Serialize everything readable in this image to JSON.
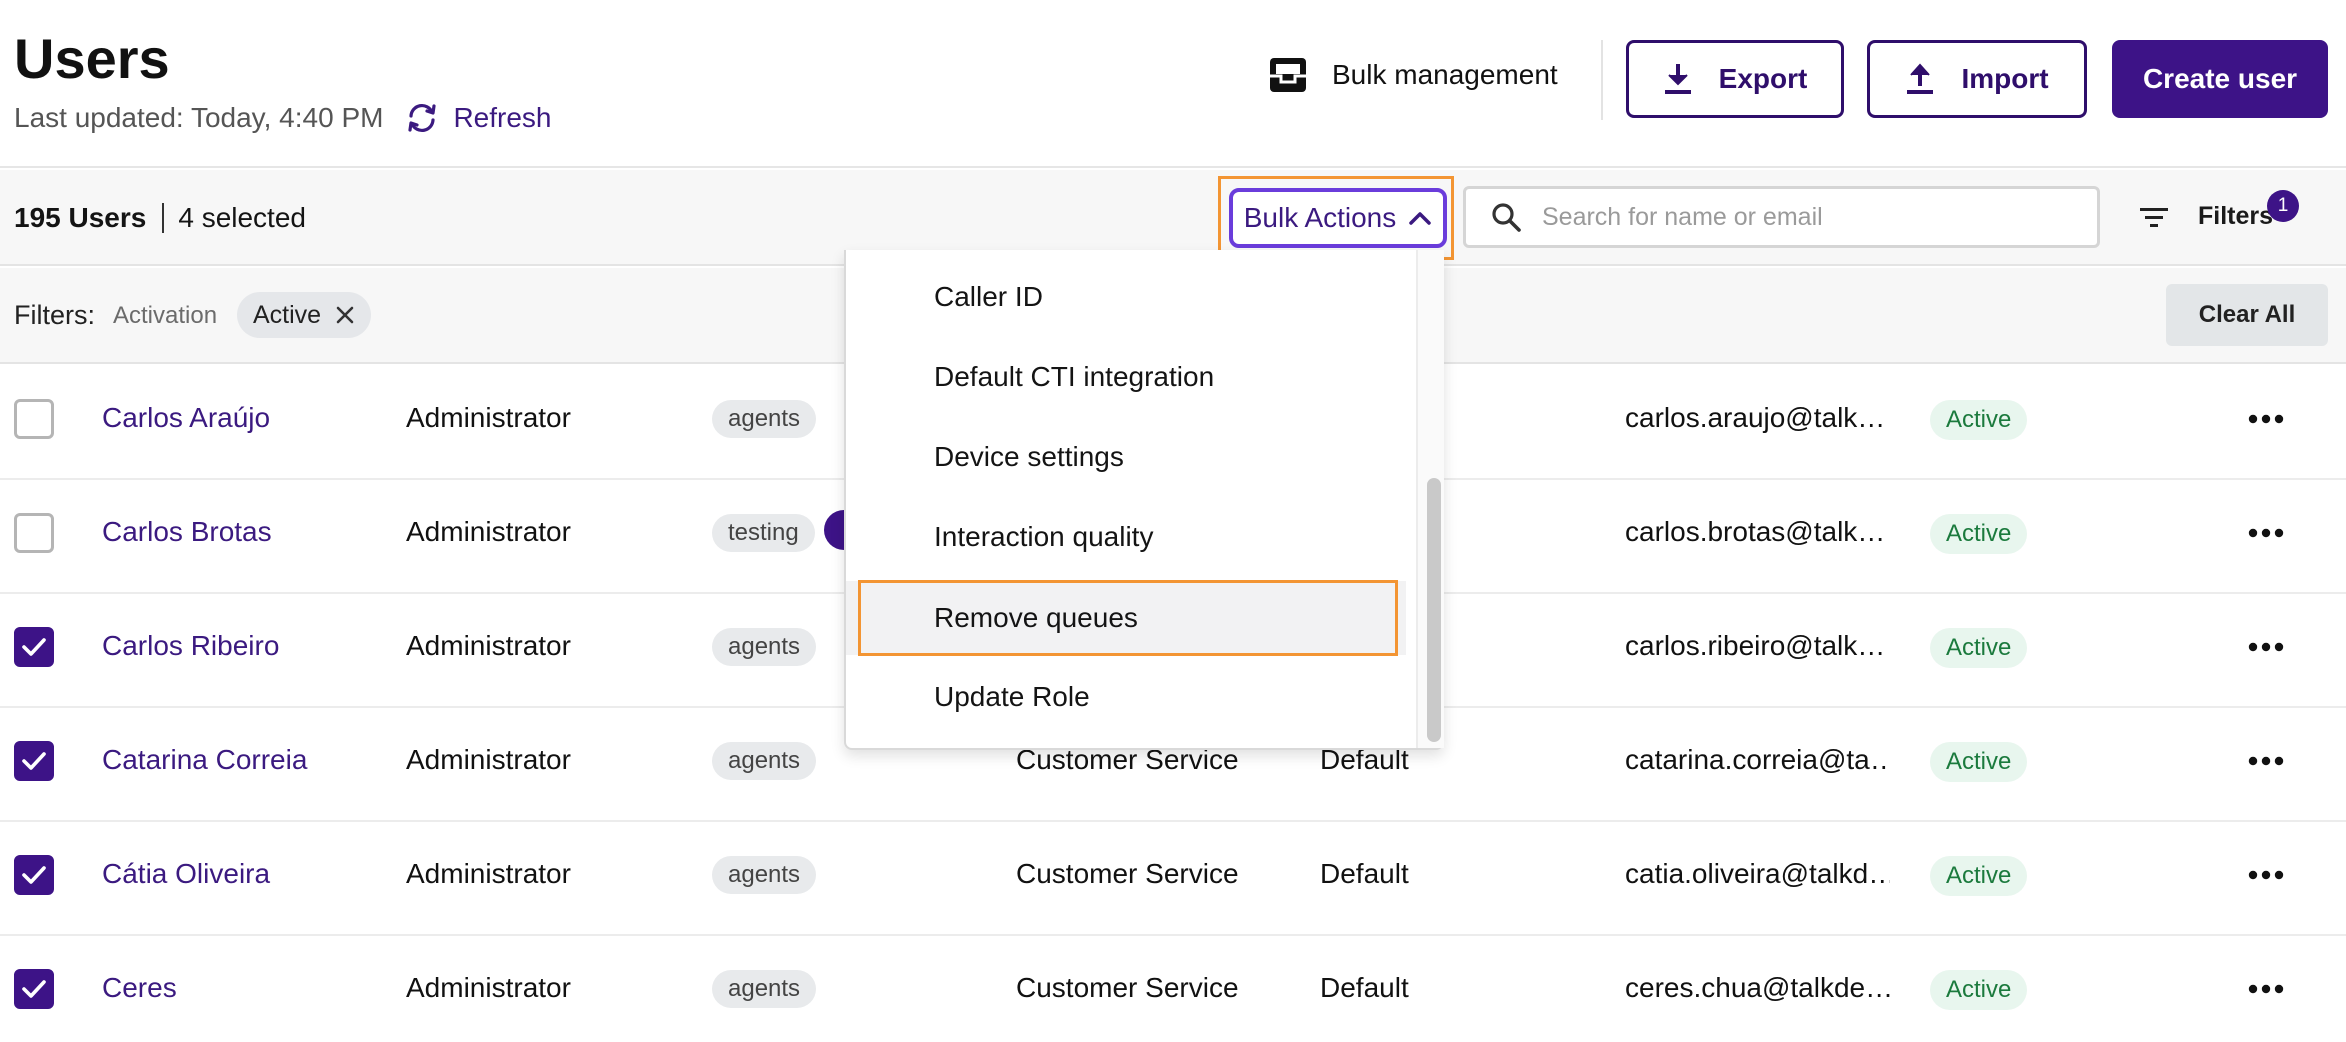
{
  "header": {
    "title": "Users",
    "last_updated": "Last updated: Today, 4:40 PM",
    "refresh_label": "Refresh",
    "bulk_management_label": "Bulk management",
    "export_label": "Export",
    "import_label": "Import",
    "create_user_label": "Create user"
  },
  "toolbar": {
    "user_count": "195 Users",
    "selected_count": "4 selected",
    "bulk_actions_label": "Bulk Actions",
    "search_placeholder": "Search for name or email",
    "filters_label": "Filters",
    "filters_badge": "1"
  },
  "filters": {
    "label": "Filters:",
    "key": "Activation",
    "chip_value": "Active",
    "clear_all_label": "Clear All"
  },
  "bulk_menu": {
    "items": [
      "Caller ID",
      "Default CTI integration",
      "Device settings",
      "Interaction quality",
      "Remove queues",
      "Update Role"
    ],
    "highlighted": "Remove queues"
  },
  "users": [
    {
      "name": "Carlos Araújo",
      "role": "Administrator",
      "group": "agents",
      "team": "",
      "profile": "",
      "email": "carlos.araujo@talk…",
      "status": "Active",
      "checked": false
    },
    {
      "name": "Carlos Brotas",
      "role": "Administrator",
      "group": "testing",
      "team": "",
      "profile": "",
      "email": "carlos.brotas@talk…",
      "status": "Active",
      "checked": false
    },
    {
      "name": "Carlos Ribeiro",
      "role": "Administrator",
      "group": "agents",
      "team": "",
      "profile": "",
      "email": "carlos.ribeiro@talk…",
      "status": "Active",
      "checked": true
    },
    {
      "name": "Catarina Correia",
      "role": "Administrator",
      "group": "agents",
      "team": "Customer Service",
      "profile": "Default",
      "email": "catarina.correia@ta…",
      "status": "Active",
      "checked": true
    },
    {
      "name": "Cátia Oliveira",
      "role": "Administrator",
      "group": "agents",
      "team": "Customer Service",
      "profile": "Default",
      "email": "catia.oliveira@talkd…",
      "status": "Active",
      "checked": true
    },
    {
      "name": "Ceres",
      "role": "Administrator",
      "group": "agents",
      "team": "Customer Service",
      "profile": "Default",
      "email": "ceres.chua@talkde…",
      "status": "Active",
      "checked": true
    }
  ],
  "colors": {
    "brand": "#3d1387",
    "highlight_outline": "#f39533",
    "status_text": "#1b7a3d",
    "status_bg": "#e8f6ee"
  }
}
